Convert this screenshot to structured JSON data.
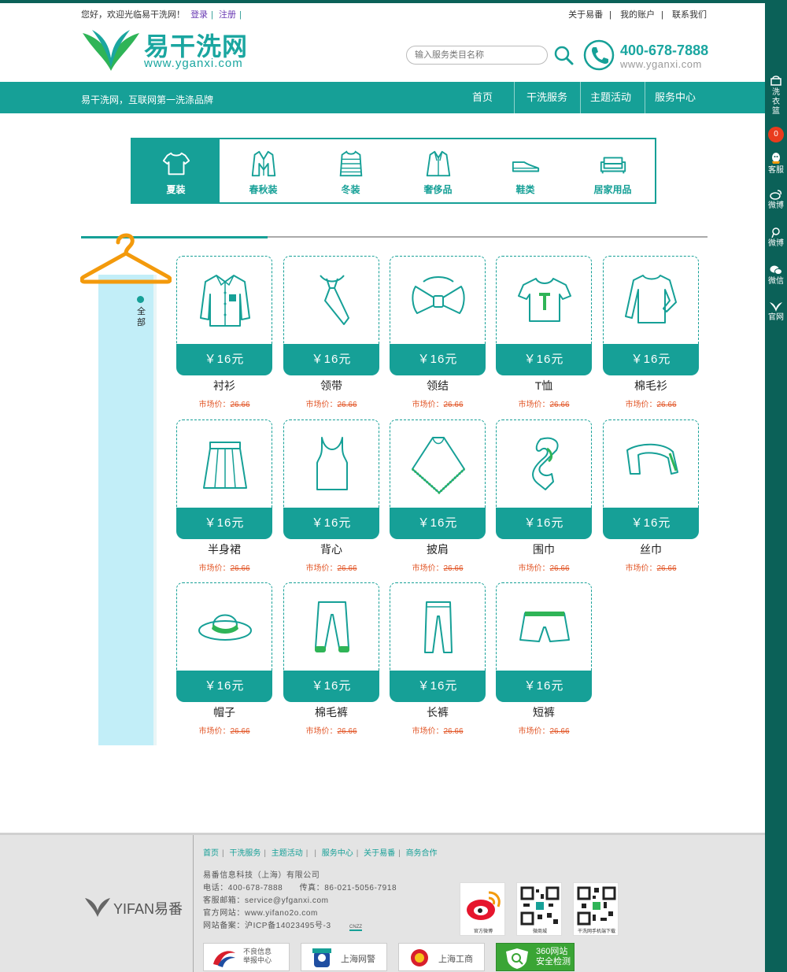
{
  "top_bar": {
    "welcome": "您好，欢迎光临易干洗网！",
    "login": "登录",
    "register": "注册",
    "links": [
      "关于易番",
      "我的账户",
      "联系我们"
    ]
  },
  "header": {
    "logo_cn": "易干洗网",
    "logo_en": "www.yganxi.com",
    "search_placeholder": "输入服务类目名称",
    "phone": "400-678-7888",
    "phone_site": "www.yganxi.com"
  },
  "nav": {
    "slogan": "易干洗网，互联网第一洗涤品牌",
    "items": [
      "首页",
      "干洗服务",
      "主题活动",
      "服务中心"
    ]
  },
  "right_bar": {
    "basket": "洗衣篮",
    "basket_count": "0",
    "items": [
      "客服",
      "微博",
      "微博",
      "微信",
      "官网"
    ]
  },
  "categories": [
    "夏装",
    "春秋装",
    "冬装",
    "奢侈品",
    "鞋类",
    "居家用品"
  ],
  "active_category": "夏装",
  "filter": {
    "label": "全部"
  },
  "products": [
    {
      "name": "衬衫",
      "price": "￥16元",
      "market_label": "市场价：",
      "market_price": "26.66",
      "icon": "shirt-icon"
    },
    {
      "name": "领带",
      "price": "￥16元",
      "market_label": "市场价：",
      "market_price": "26.66",
      "icon": "tie-icon"
    },
    {
      "name": "领结",
      "price": "￥16元",
      "market_label": "市场价：",
      "market_price": "26.66",
      "icon": "bowtie-icon"
    },
    {
      "name": "T恤",
      "price": "￥16元",
      "market_label": "市场价：",
      "market_price": "26.66",
      "icon": "tshirt-icon"
    },
    {
      "name": "棉毛衫",
      "price": "￥16元",
      "market_label": "市场价：",
      "market_price": "26.66",
      "icon": "longsleeve-icon"
    },
    {
      "name": "半身裙",
      "price": "￥16元",
      "market_label": "市场价：",
      "market_price": "26.66",
      "icon": "skirt-icon"
    },
    {
      "name": "背心",
      "price": "￥16元",
      "market_label": "市场价：",
      "market_price": "26.66",
      "icon": "vest-icon"
    },
    {
      "name": "披肩",
      "price": "￥16元",
      "market_label": "市场价：",
      "market_price": "26.66",
      "icon": "shawl-icon"
    },
    {
      "name": "围巾",
      "price": "￥16元",
      "market_label": "市场价：",
      "market_price": "26.66",
      "icon": "scarf-icon"
    },
    {
      "name": "丝巾",
      "price": "￥16元",
      "market_label": "市场价：",
      "market_price": "26.66",
      "icon": "silk-scarf-icon"
    },
    {
      "name": "帽子",
      "price": "￥16元",
      "market_label": "市场价：",
      "market_price": "26.66",
      "icon": "hat-icon"
    },
    {
      "name": "棉毛裤",
      "price": "￥16元",
      "market_label": "市场价：",
      "market_price": "26.66",
      "icon": "sweatpants-icon"
    },
    {
      "name": "长裤",
      "price": "￥16元",
      "market_label": "市场价：",
      "market_price": "26.66",
      "icon": "trousers-icon"
    },
    {
      "name": "短裤",
      "price": "￥16元",
      "market_label": "市场价：",
      "market_price": "26.66",
      "icon": "shorts-icon"
    }
  ],
  "footer": {
    "logo_text": "YIFAN易番",
    "links": [
      "首页",
      "干洗服务",
      "主题活动",
      "服务中心",
      "关于易番",
      "商务合作"
    ],
    "company": "易番信息科技（上海）有限公司",
    "phone_line": "电话：400-678-7888　　传真：86-021-5056-7918",
    "email_line": "客服邮箱：service@yfganxi.com",
    "site_line": "官方网站：www.yifano2o.com",
    "icp_line": "网站备案：沪ICP备14023495号-3",
    "cnzz": "CNZZ",
    "qr_labels": [
      "官方微博",
      "微商城",
      "干洗网手机端下载"
    ],
    "badges": [
      "不良信息举报中心",
      "上海网警",
      "上海工商",
      "360网站安全检测"
    ]
  },
  "colors": {
    "primary": "#16a097",
    "dark": "#0b6158",
    "panel": "#c2eef8",
    "accent": "#e2582a",
    "hanger": "#f39a0c"
  }
}
